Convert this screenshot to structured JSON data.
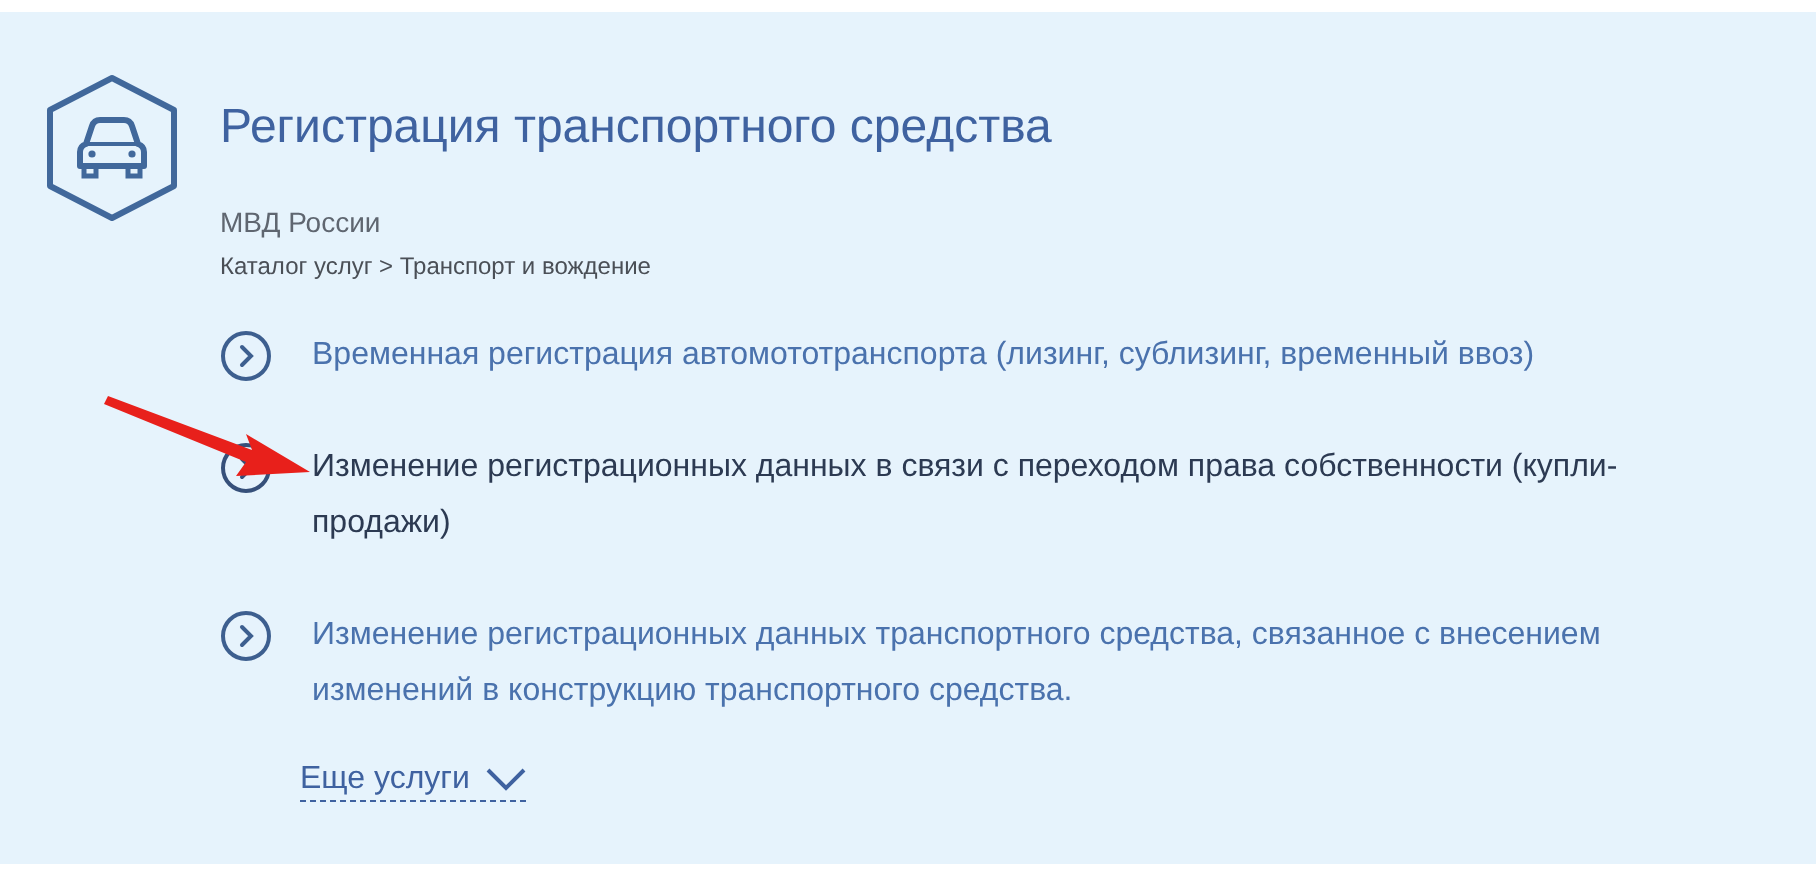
{
  "service": {
    "title": "Регистрация транспортного средства",
    "agency": "МВД России",
    "breadcrumb": "Каталог услуг > Транспорт и вождение"
  },
  "items": [
    {
      "label": "Временная регистрация автомототранспорта (лизинг, сублизинг, временный ввоз)",
      "selected": false
    },
    {
      "label": "Изменение регистрационных данных в связи с переходом права собственности (купли-продажи)",
      "selected": true
    },
    {
      "label": "Изменение регистрационных данных транспортного средства, связанное с внесением изменений в конструкцию транспортного средства.",
      "selected": false
    }
  ],
  "more": {
    "label": "Еще услуги"
  }
}
